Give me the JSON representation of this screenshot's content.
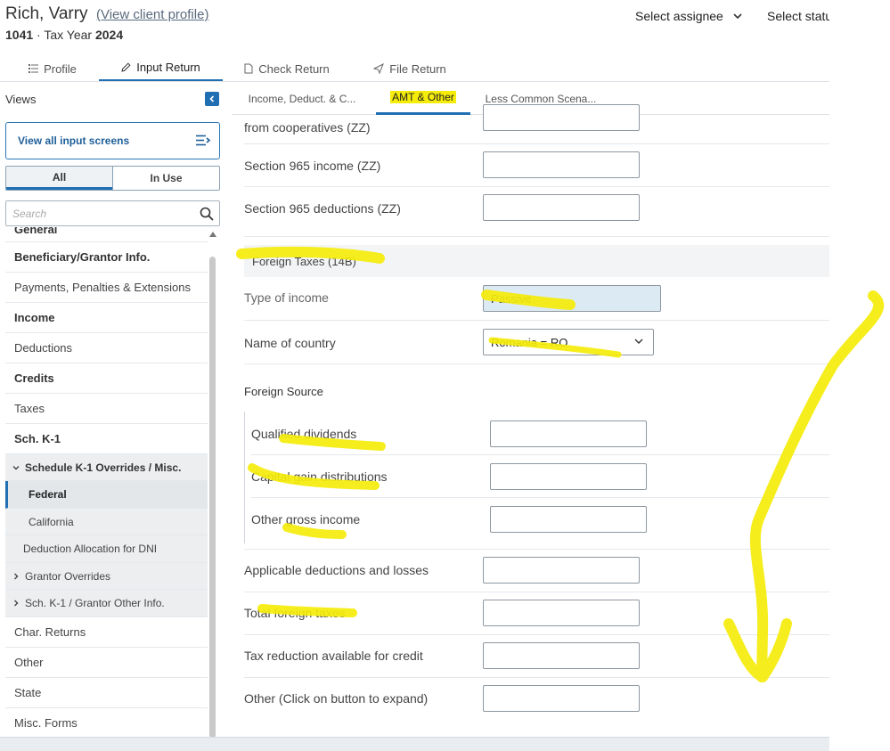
{
  "header": {
    "client_name": "Rich, Varry",
    "client_link": "(View client profile)",
    "form": "1041",
    "separator": "·",
    "tax_year_label": "Tax Year",
    "tax_year": "2024",
    "assignee": "Select assignee",
    "status": "Select statu"
  },
  "main_tabs": [
    {
      "label": "Profile",
      "icon": "list-icon"
    },
    {
      "label": "Input Return",
      "icon": "pencil-icon"
    },
    {
      "label": "Check Return",
      "icon": "document-icon"
    },
    {
      "label": "File Return",
      "icon": "send-icon"
    }
  ],
  "sidebar": {
    "views_label": "Views",
    "view_all": "View all input screens",
    "segments": [
      "All",
      "In Use"
    ],
    "search_placeholder": "Search",
    "items": [
      {
        "label": "General"
      },
      {
        "label": "Beneficiary/Grantor Info."
      },
      {
        "label": "Payments, Penalties & Extensions"
      },
      {
        "label": "Income"
      },
      {
        "label": "Deductions"
      },
      {
        "label": "Credits"
      },
      {
        "label": "Taxes"
      },
      {
        "label": "Sch. K-1"
      },
      {
        "label": "Schedule K-1 Overrides / Misc."
      },
      {
        "label": "Federal"
      },
      {
        "label": "California"
      },
      {
        "label": "Deduction Allocation for DNI"
      },
      {
        "label": "Grantor Overrides"
      },
      {
        "label": "Sch. K-1 / Grantor Other Info."
      },
      {
        "label": "Char. Returns"
      },
      {
        "label": "Other"
      },
      {
        "label": "State"
      },
      {
        "label": "Misc. Forms"
      }
    ]
  },
  "subtabs": [
    "Income, Deduct. & C...",
    "AMT & Other",
    "Less Common Scena..."
  ],
  "form": {
    "rows": [
      {
        "label": "from cooperatives (ZZ)"
      },
      {
        "label": "Section 965 income (ZZ)"
      },
      {
        "label": "Section 965 deductions (ZZ)"
      }
    ],
    "section_title": "Foreign Taxes (14B)",
    "type_of_income_label": "Type of income",
    "type_of_income_value": "Passive",
    "country_label": "Name of country",
    "country_value": "Romania = RO",
    "foreign_source_label": "Foreign Source",
    "foreign_rows": [
      {
        "label": "Qualified dividends"
      },
      {
        "label": "Capital gain distributions"
      },
      {
        "label": "Other gross income"
      }
    ],
    "bottom_rows": [
      {
        "label": "Applicable deductions and losses"
      },
      {
        "label": "Total foreign taxes"
      },
      {
        "label": "Tax reduction available for credit"
      },
      {
        "label": "Other (Click on button to expand)"
      }
    ]
  },
  "colors": {
    "accent": "#1f6fb2",
    "highlight": "#f5ec0a",
    "shaded_field": "#dceaf3"
  }
}
